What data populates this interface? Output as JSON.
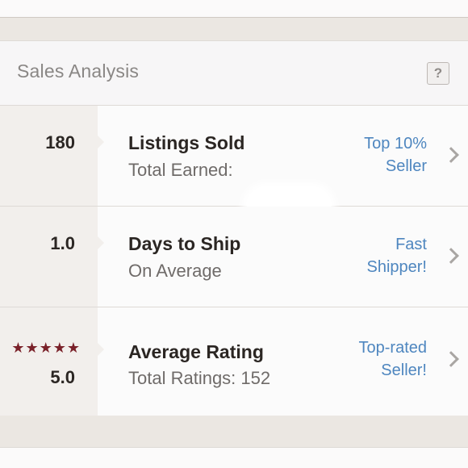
{
  "panel": {
    "title": "Sales Analysis",
    "help_label": "?"
  },
  "stats": [
    {
      "value": "180",
      "label": "Listings Sold",
      "sub": "Total Earned:",
      "badge_line1": "Top 10%",
      "badge_line2": "Seller"
    },
    {
      "value": "1.0",
      "label": "Days to Ship",
      "sub": "On Average",
      "badge_line1": "Fast",
      "badge_line2": "Shipper!"
    },
    {
      "value": "5.0",
      "stars": "★★★★★",
      "label": "Average Rating",
      "sub": "Total Ratings: 152",
      "badge_line1": "Top-rated",
      "badge_line2": "Seller!"
    }
  ],
  "colors": {
    "accent_link": "#4e86bf",
    "star": "#7a2129",
    "background": "#ebe7e2"
  },
  "icons": {
    "help": "question-mark-icon",
    "row_arrow": "chevron-right-icon",
    "rating": "star-icon"
  }
}
